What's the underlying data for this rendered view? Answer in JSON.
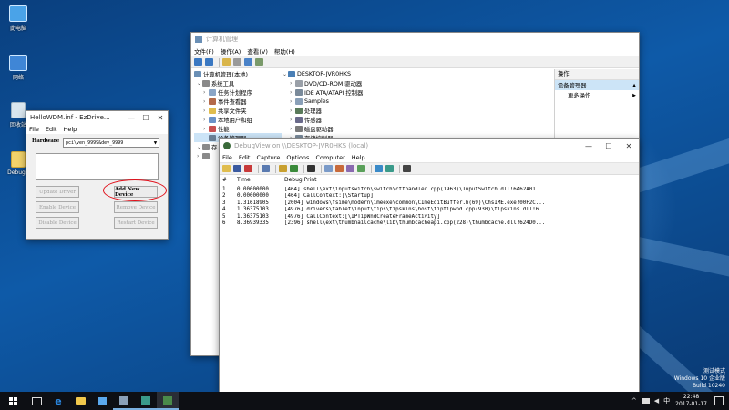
{
  "desktop": {
    "icons": [
      {
        "label": "此电脑",
        "name": "this-pc-icon",
        "color": "#4aa3e8"
      },
      {
        "label": "网络",
        "name": "network-icon",
        "color": "#3f86d6"
      },
      {
        "label": "回收站",
        "name": "recycle-bin-icon",
        "color": "#d9e6ef"
      },
      {
        "label": "DebugV",
        "name": "debugview-shortcut-icon",
        "color": "#f2d36b"
      }
    ],
    "watermark": {
      "line1": "测试模式",
      "line2": "Windows 10 企业版",
      "line3": "Build 10240"
    }
  },
  "mmc": {
    "title": "计算机管理",
    "menu": [
      "文件(F)",
      "操作(A)",
      "查看(V)",
      "帮助(H)"
    ],
    "tree_header": "计算机管理(本地)",
    "tree": [
      {
        "label": "系统工具",
        "expanded": true
      },
      {
        "label": "任务计划程序"
      },
      {
        "label": "事件查看器"
      },
      {
        "label": "共享文件夹"
      },
      {
        "label": "本地用户和组"
      },
      {
        "label": "性能"
      },
      {
        "label": "设备管理器"
      },
      {
        "label": "存"
      },
      {
        "label": ""
      }
    ],
    "device_root": "DESKTOP-JVR0HKS",
    "devices": [
      "DVD/CD-ROM 驱动器",
      "IDE ATA/ATAPI 控制器",
      "Samples",
      "处理器",
      "传感器",
      "磁盘驱动器",
      "存储控制器"
    ],
    "actions_header": "操作",
    "actions_selected": "设备管理器",
    "actions_more": "更多操作"
  },
  "hellowdm": {
    "title": "HelloWDM.inf - EzDrive...",
    "menu": [
      "File",
      "Edit",
      "Help"
    ],
    "hardware_label": "Hardware",
    "hardware_value": "pci\\ven_9999&dev_9999",
    "buttons": {
      "update": "Update Driver",
      "add": "Add New Device",
      "enable": "Enable Device",
      "remove": "Remove Device",
      "disable": "Disable Device",
      "restart": "Restart Device"
    }
  },
  "debugview": {
    "title": "DebugView on \\\\DESKTOP-JVR0HKS (local)",
    "menu": [
      "File",
      "Edit",
      "Capture",
      "Options",
      "Computer",
      "Help"
    ],
    "columns": {
      "num": "#",
      "time": "Time",
      "msg": "Debug Print"
    },
    "rows": [
      {
        "num": "1",
        "time": "0.00000000",
        "msg": "[464] shell\\ext\\inputswitch\\switch\\ctfhandler.cpp(1963)\\InputSwitch.dll!6A62A01..."
      },
      {
        "num": "2",
        "time": "0.00000000",
        "msg": "[464]    CallContext:[\\Startup]"
      },
      {
        "num": "3",
        "time": "1.31618905",
        "msg": "[2004] windows\\fsime\\modern\\imeexe\\common\\CImeEditBuffer.h(69)\\ChsIME.exe!00F2C..."
      },
      {
        "num": "4",
        "time": "1.36375103",
        "msg": "[4976] drivers\\tablet\\input\\tips\\tipskins\\host\\tiptipwnd.cpp(930)\\tipskins.dll!6..."
      },
      {
        "num": "5",
        "time": "1.36375103",
        "msg": "[4976]    CallContext:[\\IPTipWndCreateFrameActivity]"
      },
      {
        "num": "6",
        "time": "8.36939335",
        "msg": "[2396] shell\\ext\\thumbnailcache\\lib\\thumbcacheapi.cpp(228)\\thumbcache.dll!624D0..."
      }
    ]
  },
  "taskbar": {
    "time": "22:48",
    "date": "2017-01-17",
    "ime": "中",
    "colors": {
      "start": "#ffffff",
      "edge": "#2b8be8",
      "store": "#5aa9ee",
      "folder": "#f1c84c"
    }
  }
}
